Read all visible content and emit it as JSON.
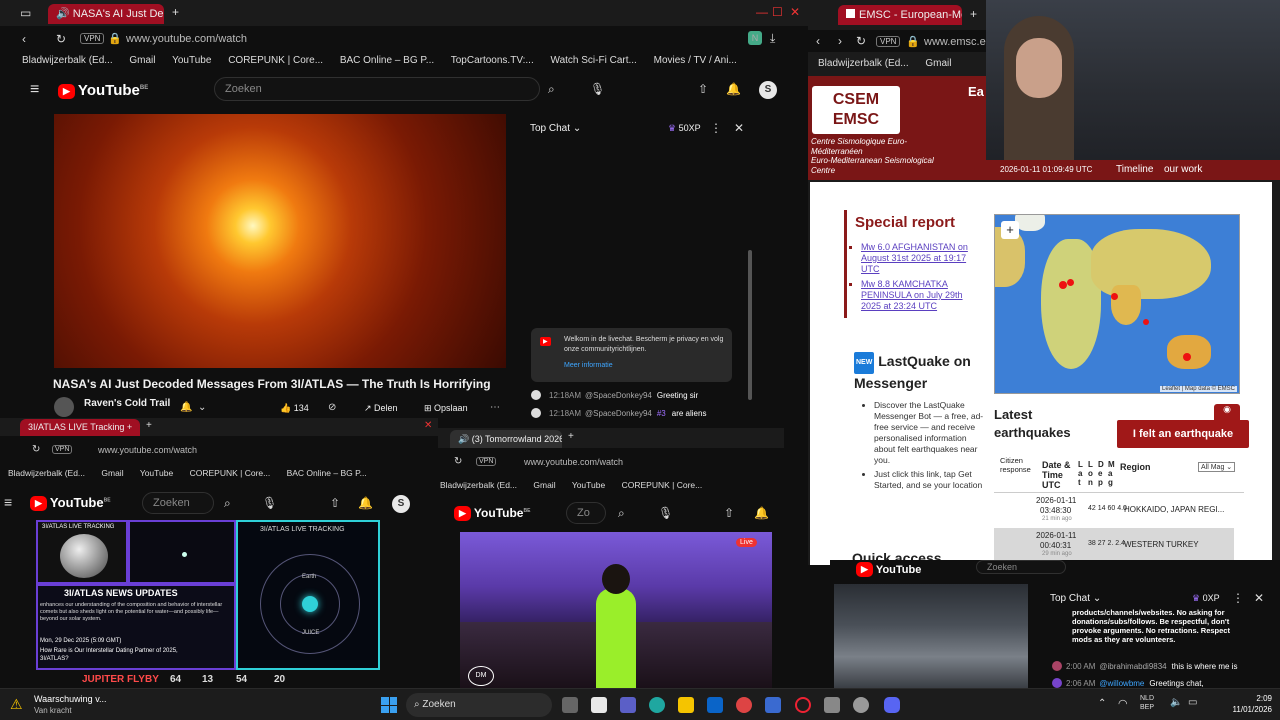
{
  "main_window": {
    "tab_title": "NASA's AI Just Decod",
    "vpn": "VPN",
    "url": "www.youtube.com/watch",
    "bookmarks": [
      "Bladwijzerbalk (Ed...",
      "Gmail",
      "YouTube",
      "COREPUNK | Core...",
      "BAC Online – BG P...",
      "TopCartoons.TV:...",
      "Watch Sci-Fi Cart...",
      "Movies / TV / Ani..."
    ],
    "logo": "YouTube",
    "logo_sup": "BE",
    "search_placeholder": "Zoeken",
    "avatar_letter": "S",
    "video_title": "NASA's AI Just Decoded Messages From 3I/ATLAS — The Truth Is Horrifying",
    "channel": "Raven's Cold Trail",
    "likes": "134",
    "share_label": "Delen",
    "save_label": "Opslaan",
    "chat": {
      "header": "Top Chat",
      "xp": "50XP",
      "welcome": "Welkom in de livechat. Bescherm je privacy en volg onze communityrichtlijnen.",
      "more_info": "Meer informatie",
      "messages": [
        {
          "time": "12:18AM",
          "user": "@SpaceDonkey94",
          "badge": "",
          "text": "Greeting sir"
        },
        {
          "time": "12:18AM",
          "user": "@SpaceDonkey94",
          "badge": "#3",
          "text": "are aliens"
        }
      ]
    }
  },
  "emsc_window": {
    "tab_title": "EMSC - European-Mediter",
    "vpn": "VPN",
    "url": "www.emsc.eu",
    "bookmarks": [
      "Bladwijzerbalk (Ed...",
      "Gmail"
    ],
    "logo_top": "CSEM",
    "logo_bottom": "EMSC",
    "org_fr": "Centre Sismologique Euro-Méditerranéen",
    "org_en": "Euro-Mediterranean Seismological Centre",
    "header_word": "Ea",
    "side_text": [
      "Wo",
      "Lat",
      "ear",
      "Sei",
      "Spe"
    ],
    "datetime": "2026-01-11 01:09:49 UTC",
    "nav": [
      "Timeline",
      "our work"
    ],
    "special_report_title": "Special report",
    "reports": [
      "Mw 6.0 AFGHANISTAN on August 31st 2025 at 19:17 UTC",
      "Mw 8.8 KAMCHATKA PENINSULA on July 29th 2025 at 23:24 UTC"
    ],
    "map_zoom": "+",
    "map_attribution": "Leaflet | Map data © EMSC",
    "lastquake_title": "LastQuake on Messenger",
    "lastquake_new": "NEW",
    "lastquake_bullets": [
      "Discover the LastQuake Messenger Bot — a free, ad-free service — and receive personalised information about felt earthquakes near you.",
      "Just click this link, tap Get Started, and se your location"
    ],
    "latest_title": "Latest earthquakes",
    "felt_button": "I felt an earthquake",
    "table_headers": [
      "Citizen response",
      "Date & Time UTC",
      "L a t",
      "L o n",
      "D e p",
      "M a g",
      "Region"
    ],
    "mag_filter": "All Mag",
    "quakes": [
      {
        "date": "2026-01-11",
        "time": "03:48:30",
        "ago": "21 min ago",
        "vals": "42 14 60 4.0",
        "region": "HOKKAIDO, JAPAN REGI..."
      },
      {
        "date": "2026-01-11",
        "time": "00:40:31",
        "ago": "29 min ago",
        "vals": "38 27 2. 2.4",
        "region": "WESTERN TURKEY"
      }
    ],
    "quick_access": "Quick access"
  },
  "atlas_window": {
    "tab_title": "3I/ATLAS LIVE Tracking +",
    "vpn": "VPN",
    "url": "www.youtube.com/watch",
    "bookmarks": [
      "Bladwijzerbalk (Ed...",
      "Gmail",
      "YouTube",
      "COREPUNK | Core...",
      "BAC Online – BG P..."
    ],
    "logo": "YouTube",
    "logo_sup": "BE",
    "search_placeholder": "Zoeken",
    "avatar_letter": "S",
    "panel_label_1": "3I/ATLAS LIVE TRACKING",
    "panel_label_2": "3I/ATLAS LIVE TRACKING",
    "news_title": "3I/ATLAS NEWS UPDATES",
    "news_text": "enhances our understanding of the composition and behavior of interstellar comets but also sheds light on the potential for water—and possibly life—beyond our solar system.",
    "news_date": "Mon, 29 Dec 2025 (5:09 GMT)",
    "news_headline": "How Rare is Our Interstellar Dating Partner of 2025, 3I/ATLAS?",
    "orbit_labels": [
      "Earth",
      "JUICE"
    ],
    "flyby_label": "JUPITER FLYBY",
    "flyby_values": [
      "64",
      "13",
      "54",
      "20"
    ]
  },
  "tomorrowland_window": {
    "tab_title": "(3) Tomorrowland 2026",
    "vpn": "VPN",
    "url": "www.youtube.com/watch",
    "bookmarks": [
      "Bladwijzerbalk (Ed...",
      "Gmail",
      "YouTube",
      "COREPUNK | Core..."
    ],
    "logo": "YouTube",
    "logo_sup": "BE",
    "search_placeholder": "Zo",
    "live_badge": "Live",
    "stage_logo": "DM"
  },
  "small_youtube": {
    "logo": "YouTube",
    "search_placeholder": "Zoeken",
    "chat_header": "Top Chat",
    "xp": "0XP",
    "rules_text": "products/channels/websites. No asking for donations/subs/follows. Be respectful, don't provoke arguments. No retractions. Respect mods as they are volunteers.",
    "messages": [
      {
        "time": "2:00 AM",
        "user": "@ibrahimabdi9834",
        "text": "this is where me is"
      },
      {
        "time": "2:06 AM",
        "user": "@willowbme",
        "text": "Greetings chat,"
      }
    ]
  },
  "taskbar": {
    "warning_title": "Waarschuwing v...",
    "warning_sub": "Van kracht",
    "search_label": "Zoeken",
    "lang_1": "NLD",
    "lang_2": "BEP",
    "time": "2:09",
    "date": "11/01/2026"
  },
  "colors": {
    "brand_red": "#a00f22",
    "youtube_red": "#ff0000",
    "emsc_red": "#8b1a1a",
    "emsc_link": "#5a3fc0",
    "atlas_cyan": "#2fd0d8"
  }
}
